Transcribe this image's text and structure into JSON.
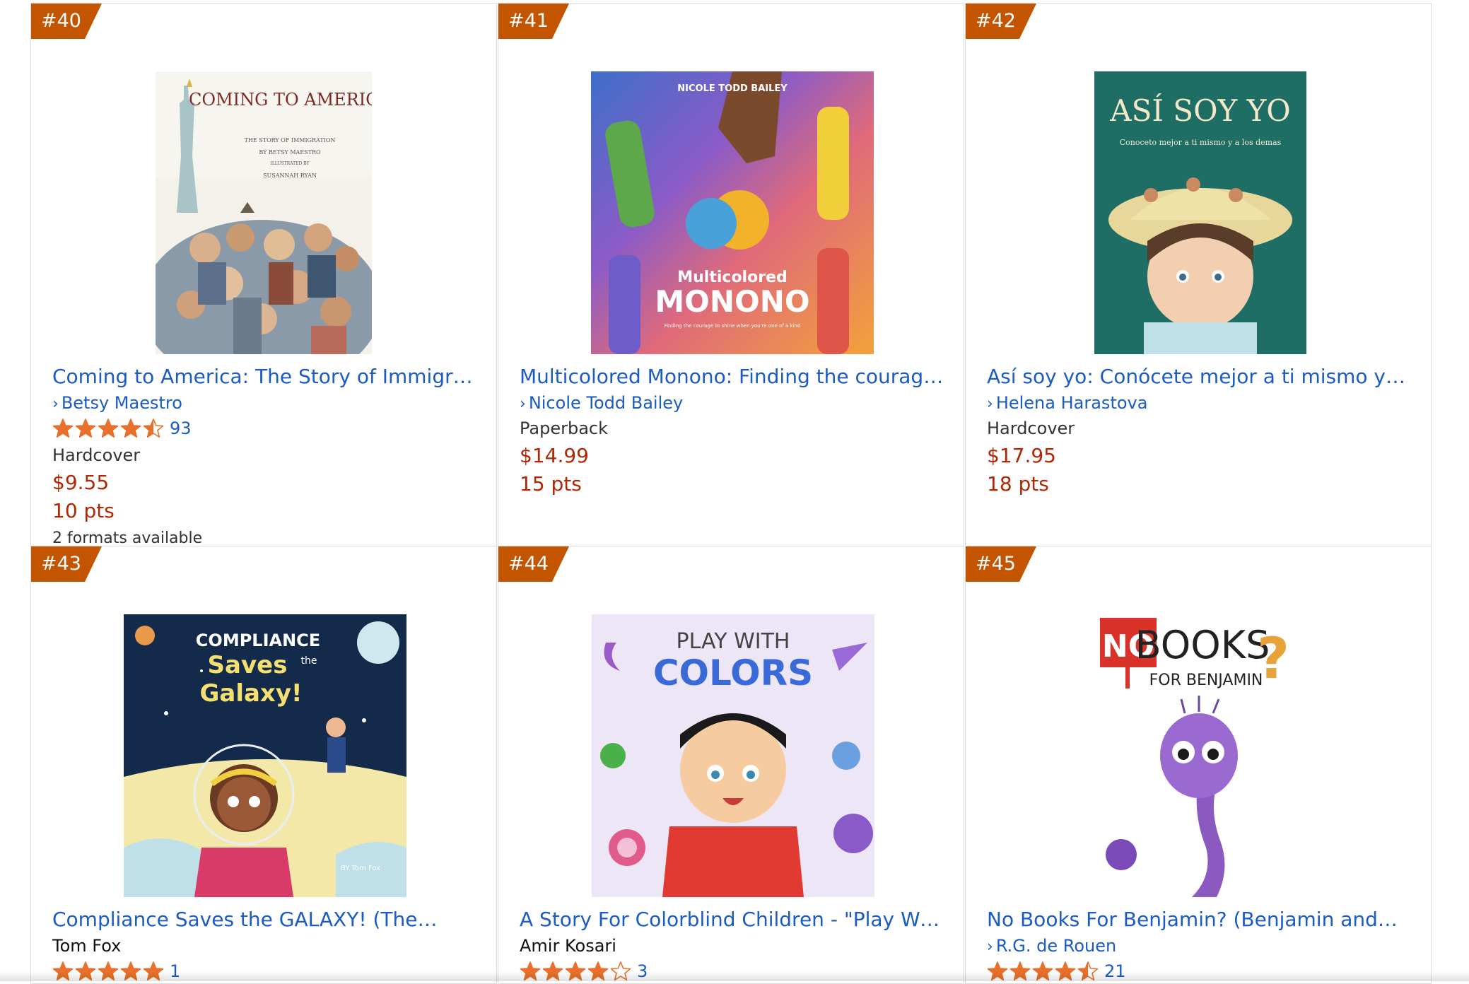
{
  "colors": {
    "badge": "#c45500",
    "link": "#1a5bc4",
    "price": "#b12704",
    "star": "#e8702a"
  },
  "products": [
    {
      "rank": "#40",
      "title": "Coming to America: The Story of Immigration",
      "author": "Betsy Maestro",
      "author_is_link": true,
      "rating": 4.5,
      "review_count": "93",
      "format": "Hardcover",
      "price": "$9.55",
      "points": "10 pts",
      "formats_available": "2 formats available",
      "cover": {
        "title": "COMING TO AMERICA",
        "subtitle": "THE STORY OF IMMIGRATION",
        "byline": "BY BETSY MAESTRO",
        "illustrated": "ILLUSTRATED BY",
        "illustrator": "SUSANNAH RYAN"
      }
    },
    {
      "rank": "#41",
      "title": "Multicolored Monono: Finding the courage t…",
      "author": "Nicole Todd Bailey",
      "author_is_link": true,
      "format": "Paperback",
      "price": "$14.99",
      "points": "15 pts",
      "cover": {
        "author": "NICOLE TODD BAILEY",
        "title_line1": "Multicolored",
        "title_line2": "MONONO",
        "tagline": "Finding the courage to shine when you're one of a kind"
      }
    },
    {
      "rank": "#42",
      "title": "Así soy yo: Conócete mejor a ti mismo y a los…",
      "author": "Helena Harastova",
      "author_is_link": true,
      "format": "Hardcover",
      "price": "$17.95",
      "points": "18 pts",
      "cover": {
        "title": "ASÍ SOY YO",
        "subtitle": "Conoceto mejor a ti mismo y a los demas"
      }
    },
    {
      "rank": "#43",
      "title": "Compliance Saves the GALAXY! (The…",
      "author": "Tom Fox",
      "author_is_link": false,
      "rating": 5,
      "review_count": "1",
      "cover": {
        "line1": "COMPLIANCE",
        "line2": "Saves",
        "line2b": "the",
        "line3": "Galaxy!",
        "byline": "BY Tom Fox"
      }
    },
    {
      "rank": "#44",
      "title": "A Story For Colorblind Children - \"Play With…",
      "author": "Amir Kosari",
      "author_is_link": false,
      "rating": 4,
      "review_count": "3",
      "cover": {
        "line1": "PLAY WITH",
        "line2": "COLORS"
      }
    },
    {
      "rank": "#45",
      "title": "No Books For Benjamin? (Benjamin and…",
      "author": "R.G. de Rouen",
      "author_is_link": true,
      "rating": 4.5,
      "review_count": "21",
      "cover": {
        "no": "NO",
        "books": "BOOKS",
        "qmark": "?",
        "for_benjamin": "FOR BENJAMIN"
      }
    }
  ]
}
